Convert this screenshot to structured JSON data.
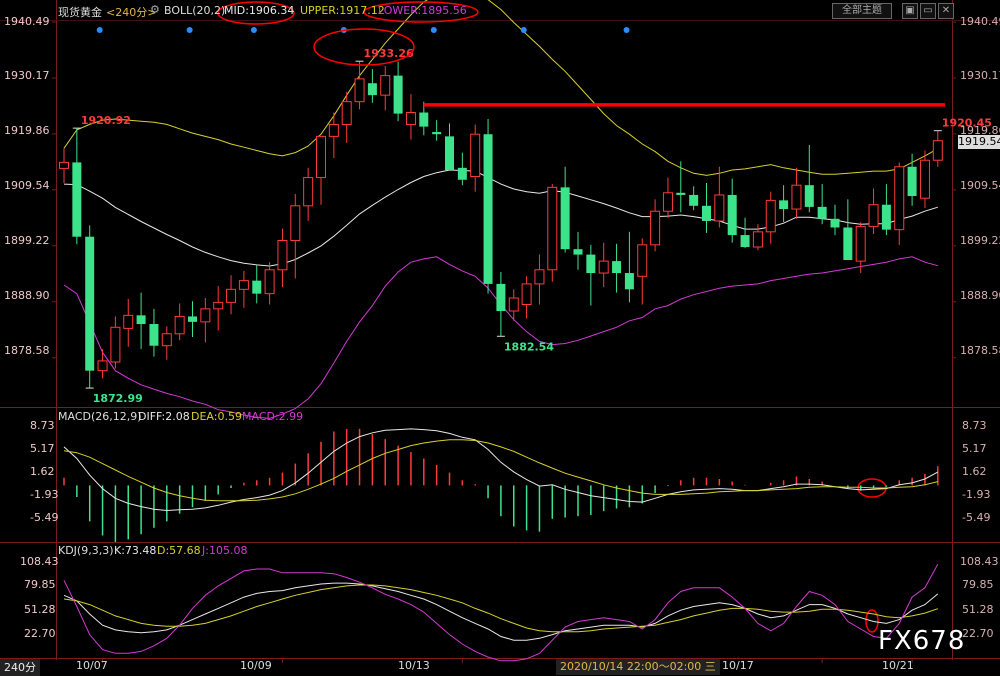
{
  "header": {
    "symbol": "现货黄金",
    "period": "<240分>",
    "boll": "BOLL(20,2)",
    "mid": "MID:1906.34",
    "upper": "UPPER:1917.12",
    "lower": "LOWER:1895.56",
    "theme_button": "全部主题",
    "window_buttons": [
      "▣",
      "▭",
      "✕"
    ]
  },
  "colors": {
    "up": "#ff3a3a",
    "down": "#3de38a",
    "mid": "#e8e8e8",
    "upper": "#d8d02a",
    "lower": "#d43ad4",
    "annot": "#ff0000"
  },
  "chart_data": {
    "type": "candlestick",
    "price_axis": {
      "min": 1869.5,
      "max": 1940.49,
      "ticks": [
        "1940.49",
        "1930.17",
        "1919.86",
        "1909.54",
        "1899.22",
        "1888.90",
        "1878.58"
      ]
    },
    "price_axis_right": [
      "1940.49",
      "1930.17",
      "1919.86",
      "1909.54",
      "1899.22",
      "1888.90",
      "1878.58"
    ],
    "right_current": "1919.54",
    "candles": [
      [
        1913.5,
        1917.2,
        1910.8,
        1914.6
      ],
      [
        1914.6,
        1920.9,
        1899.5,
        1900.9
      ],
      [
        1900.9,
        1903.0,
        1872.99,
        1876.2
      ],
      [
        1876.2,
        1880.2,
        1874.8,
        1878.0
      ],
      [
        1877.8,
        1886.2,
        1876.6,
        1884.2
      ],
      [
        1884.0,
        1889.4,
        1880.6,
        1886.4
      ],
      [
        1886.4,
        1890.6,
        1880.2,
        1884.8
      ],
      [
        1884.8,
        1887.6,
        1878.8,
        1880.8
      ],
      [
        1880.8,
        1884.4,
        1878.2,
        1883.0
      ],
      [
        1883.0,
        1888.6,
        1881.8,
        1886.2
      ],
      [
        1886.2,
        1889.0,
        1882.4,
        1885.2
      ],
      [
        1885.2,
        1889.6,
        1881.4,
        1887.6
      ],
      [
        1887.6,
        1891.8,
        1883.6,
        1888.8
      ],
      [
        1888.8,
        1893.8,
        1886.6,
        1891.2
      ],
      [
        1891.2,
        1894.6,
        1887.8,
        1892.8
      ],
      [
        1892.8,
        1895.6,
        1888.6,
        1890.4
      ],
      [
        1890.4,
        1896.2,
        1888.4,
        1894.8
      ],
      [
        1894.8,
        1902.4,
        1891.6,
        1900.2
      ],
      [
        1900.2,
        1908.8,
        1893.2,
        1906.6
      ],
      [
        1906.6,
        1913.6,
        1903.8,
        1911.8
      ],
      [
        1911.8,
        1916.8,
        1906.8,
        1919.4
      ],
      [
        1919.4,
        1923.8,
        1915.4,
        1921.6
      ],
      [
        1921.6,
        1927.6,
        1918.2,
        1925.8
      ],
      [
        1925.8,
        1933.26,
        1924.4,
        1930.0
      ],
      [
        1929.2,
        1931.8,
        1925.6,
        1927.0
      ],
      [
        1927.0,
        1932.4,
        1924.2,
        1930.6
      ],
      [
        1930.6,
        1933.2,
        1922.2,
        1923.6
      ],
      [
        1921.6,
        1927.2,
        1918.8,
        1923.8
      ],
      [
        1923.8,
        1925.8,
        1919.6,
        1921.2
      ],
      [
        1920.2,
        1922.4,
        1918.6,
        1919.8
      ],
      [
        1919.4,
        1921.8,
        1913.8,
        1913.2
      ],
      [
        1913.6,
        1916.4,
        1910.4,
        1911.4
      ],
      [
        1912.0,
        1921.6,
        1909.2,
        1919.8
      ],
      [
        1919.8,
        1922.6,
        1890.4,
        1892.2
      ],
      [
        1892.2,
        1894.4,
        1882.54,
        1887.2
      ],
      [
        1887.2,
        1891.2,
        1885.4,
        1889.6
      ],
      [
        1888.4,
        1893.6,
        1885.8,
        1892.2
      ],
      [
        1892.2,
        1897.6,
        1888.4,
        1894.8
      ],
      [
        1894.8,
        1910.6,
        1892.6,
        1910.0
      ],
      [
        1910.0,
        1913.8,
        1898.0,
        1898.6
      ],
      [
        1898.6,
        1901.8,
        1894.8,
        1897.6
      ],
      [
        1897.6,
        1899.4,
        1888.2,
        1894.2
      ],
      [
        1894.2,
        1899.8,
        1891.6,
        1896.4
      ],
      [
        1896.4,
        1899.6,
        1890.6,
        1894.2
      ],
      [
        1894.2,
        1901.8,
        1888.8,
        1891.2
      ],
      [
        1893.6,
        1900.6,
        1888.4,
        1899.4
      ],
      [
        1899.4,
        1907.8,
        1898.2,
        1905.6
      ],
      [
        1905.6,
        1911.8,
        1904.4,
        1909.0
      ],
      [
        1909.0,
        1914.8,
        1905.4,
        1908.6
      ],
      [
        1908.6,
        1910.2,
        1905.8,
        1906.6
      ],
      [
        1906.6,
        1910.8,
        1901.6,
        1903.8
      ],
      [
        1903.8,
        1913.8,
        1902.6,
        1908.6
      ],
      [
        1908.6,
        1911.6,
        1899.8,
        1901.2
      ],
      [
        1901.2,
        1904.4,
        1898.8,
        1899.0
      ],
      [
        1899.0,
        1903.2,
        1898.4,
        1901.8
      ],
      [
        1901.8,
        1909.2,
        1899.6,
        1907.6
      ],
      [
        1907.6,
        1910.4,
        1903.6,
        1906.0
      ],
      [
        1906.0,
        1913.6,
        1904.2,
        1910.4
      ],
      [
        1910.4,
        1917.8,
        1905.4,
        1906.4
      ],
      [
        1906.4,
        1910.6,
        1903.2,
        1904.2
      ],
      [
        1904.2,
        1906.8,
        1901.2,
        1902.6
      ],
      [
        1902.6,
        1907.8,
        1899.2,
        1896.6
      ],
      [
        1896.4,
        1903.6,
        1894.2,
        1902.8
      ],
      [
        1902.8,
        1909.8,
        1901.4,
        1906.8
      ],
      [
        1906.8,
        1910.6,
        1901.2,
        1902.2
      ],
      [
        1902.2,
        1914.6,
        1899.4,
        1913.8
      ],
      [
        1913.8,
        1916.2,
        1906.6,
        1908.4
      ],
      [
        1908.0,
        1916.8,
        1906.2,
        1915.0
      ],
      [
        1915.0,
        1920.45,
        1913.8,
        1918.6
      ]
    ],
    "mid_line": [
      1910.6,
      1910.5,
      1909.3,
      1908.0,
      1906.3,
      1905.0,
      1903.7,
      1902.5,
      1901.3,
      1900.2,
      1899.0,
      1898.0,
      1897.2,
      1896.5,
      1896.0,
      1895.7,
      1895.5,
      1895.9,
      1896.7,
      1897.9,
      1899.2,
      1901.0,
      1903.0,
      1905.1,
      1906.7,
      1908.2,
      1909.6,
      1910.9,
      1912.0,
      1912.7,
      1913.2,
      1913.1,
      1913.0,
      1911.8,
      1910.6,
      1909.7,
      1909.2,
      1908.9,
      1909.4,
      1909.1,
      1908.4,
      1907.7,
      1907.0,
      1906.2,
      1905.3,
      1904.6,
      1904.6,
      1904.7,
      1904.9,
      1904.6,
      1904.2,
      1903.8,
      1903.0,
      1902.3,
      1902.3,
      1902.7,
      1903.4,
      1904.5,
      1904.5,
      1904.2,
      1904.0,
      1903.5,
      1903.2,
      1903.3,
      1903.3,
      1904.1,
      1904.7,
      1905.6,
      1906.34
    ],
    "upper_line": [
      1917.2,
      1920.6,
      1921.6,
      1922.4,
      1922.6,
      1922.4,
      1922.2,
      1922.0,
      1921.6,
      1920.8,
      1920.0,
      1919.4,
      1918.8,
      1918.0,
      1917.4,
      1916.8,
      1916.2,
      1915.8,
      1916.4,
      1917.6,
      1919.8,
      1923.2,
      1927.0,
      1930.6,
      1933.6,
      1936.6,
      1939.2,
      1941.8,
      1944.2,
      1945.6,
      1946.8,
      1946.6,
      1946.2,
      1944.6,
      1942.8,
      1940.4,
      1938.2,
      1936.0,
      1933.6,
      1931.4,
      1928.8,
      1926.2,
      1923.6,
      1921.4,
      1919.8,
      1918.0,
      1916.6,
      1914.8,
      1913.6,
      1912.6,
      1912.2,
      1912.6,
      1913.2,
      1913.4,
      1913.8,
      1914.2,
      1913.6,
      1913.2,
      1912.8,
      1912.4,
      1912.4,
      1912.6,
      1912.8,
      1913.0,
      1913.0,
      1913.4,
      1914.6,
      1915.8,
      1917.12
    ],
    "lower_line": [
      1892.0,
      1890.4,
      1885.0,
      1879.6,
      1876.2,
      1874.8,
      1873.6,
      1872.8,
      1872.0,
      1871.4,
      1870.6,
      1870.0,
      1869.0,
      1868.6,
      1868.0,
      1867.6,
      1867.4,
      1868.2,
      1869.2,
      1871.0,
      1873.8,
      1877.6,
      1881.6,
      1885.2,
      1888.2,
      1891.8,
      1894.4,
      1896.2,
      1896.8,
      1897.2,
      1895.8,
      1894.6,
      1893.6,
      1891.4,
      1888.4,
      1885.6,
      1883.4,
      1881.6,
      1881.0,
      1881.2,
      1881.8,
      1882.6,
      1883.4,
      1884.2,
      1885.4,
      1886.0,
      1887.6,
      1888.2,
      1889.4,
      1890.2,
      1890.8,
      1891.4,
      1891.8,
      1892.0,
      1892.2,
      1892.8,
      1893.2,
      1893.6,
      1894.0,
      1894.2,
      1894.6,
      1895.0,
      1895.4,
      1895.8,
      1896.2,
      1896.8,
      1897.2,
      1896.2,
      1895.56
    ],
    "resistance_level": 1925.2,
    "markers": [
      2,
      9,
      14,
      21,
      28,
      35,
      43
    ],
    "annotations": [
      {
        "text": "1920.92",
        "price": 1920.92,
        "index": 1,
        "color": "#ff3a3a"
      },
      {
        "text": "1933.26",
        "price": 1933.26,
        "index": 23,
        "color": "#ff3a3a"
      },
      {
        "text": "1872.99",
        "price": 1872.99,
        "index": 2,
        "color": "#3de38a"
      },
      {
        "text": "1882.54",
        "price": 1882.54,
        "index": 34,
        "color": "#3de38a"
      },
      {
        "text": "1920.45",
        "price": 1920.45,
        "index": 68,
        "color": "#ff3a3a"
      }
    ],
    "macd": {
      "title": "MACD(26,12,9)",
      "diff": "DIFF:2.08",
      "dea": "DEA:0.59",
      "macd": "MACD:2.99",
      "axis": {
        "min": -8.5,
        "max": 10.5,
        "ticks": [
          "8.73",
          "5.17",
          "1.62",
          "-1.93",
          "-5.49"
        ]
      },
      "diff_line": [
        6.0,
        4.2,
        1.6,
        -0.5,
        -2.0,
        -2.8,
        -3.3,
        -3.7,
        -3.9,
        -3.8,
        -3.7,
        -3.5,
        -3.1,
        -2.6,
        -2.2,
        -1.9,
        -1.5,
        -0.8,
        0.4,
        1.9,
        3.6,
        5.3,
        6.6,
        7.6,
        8.2,
        8.6,
        8.7,
        8.8,
        8.7,
        8.5,
        8.1,
        7.5,
        7.1,
        5.6,
        3.6,
        2.1,
        0.9,
        -0.1,
        0.1,
        -0.6,
        -1.1,
        -1.6,
        -1.9,
        -2.2,
        -2.5,
        -2.6,
        -2.0,
        -1.4,
        -1.0,
        -0.7,
        -0.6,
        -0.5,
        -0.6,
        -0.8,
        -0.8,
        -0.5,
        -0.2,
        0.2,
        0.2,
        0.1,
        -0.2,
        -0.5,
        -0.7,
        -0.6,
        -0.5,
        0.1,
        0.4,
        1.0,
        2.08
      ],
      "dea_line": [
        5.4,
        5.1,
        4.4,
        3.4,
        2.4,
        1.4,
        0.5,
        -0.4,
        -1.1,
        -1.6,
        -2.0,
        -2.3,
        -2.4,
        -2.4,
        -2.4,
        -2.3,
        -2.1,
        -1.8,
        -1.3,
        -0.6,
        0.2,
        1.1,
        2.2,
        3.2,
        4.2,
        5.0,
        5.6,
        6.2,
        6.6,
        6.9,
        7.1,
        7.1,
        7.0,
        6.6,
        6.0,
        5.3,
        4.4,
        3.5,
        2.7,
        1.9,
        1.3,
        0.7,
        0.1,
        -0.4,
        -0.8,
        -1.2,
        -1.4,
        -1.4,
        -1.4,
        -1.3,
        -1.2,
        -1.0,
        -0.9,
        -0.8,
        -0.8,
        -0.7,
        -0.6,
        -0.5,
        -0.3,
        -0.2,
        -0.2,
        -0.3,
        -0.3,
        -0.4,
        -0.4,
        -0.3,
        -0.2,
        0.1,
        0.59
      ],
      "hist": [
        1.2,
        -1.8,
        -5.6,
        -7.8,
        -8.8,
        -8.4,
        -7.6,
        -6.6,
        -5.6,
        -4.4,
        -3.4,
        -2.4,
        -1.4,
        -0.4,
        0.4,
        0.8,
        1.2,
        2.0,
        3.4,
        5.0,
        6.8,
        8.4,
        8.8,
        8.8,
        8.0,
        7.2,
        6.2,
        5.2,
        4.2,
        3.2,
        2.0,
        0.8,
        0.2,
        -2.0,
        -4.8,
        -6.4,
        -7.0,
        -7.2,
        -5.2,
        -5.0,
        -4.8,
        -4.6,
        -4.0,
        -3.6,
        -3.4,
        -2.8,
        -1.2,
        -0.1,
        0.8,
        1.2,
        1.2,
        1.0,
        0.6,
        0.1,
        0.0,
        0.4,
        0.8,
        1.4,
        1.0,
        0.6,
        0.0,
        -0.4,
        -0.8,
        -0.4,
        -0.2,
        0.8,
        1.2,
        1.8,
        2.99
      ]
    },
    "kdj": {
      "title": "KDJ(9,3,3)",
      "k": "K:73.48",
      "d": "D:57.68",
      "j": "J:105.08",
      "axis": {
        "min": 5,
        "max": 115,
        "ticks": [
          "108.43",
          "79.85",
          "51.28",
          "22.70"
        ]
      },
      "k_line": [
        72,
        66,
        52,
        40,
        35,
        33,
        32,
        33,
        35,
        40,
        46,
        52,
        58,
        64,
        70,
        74,
        76,
        77,
        80,
        82,
        84,
        85,
        85,
        84,
        82,
        79,
        76,
        72,
        68,
        62,
        55,
        48,
        42,
        36,
        28,
        24,
        24,
        26,
        30,
        34,
        36,
        38,
        40,
        40,
        40,
        38,
        42,
        50,
        56,
        60,
        62,
        64,
        62,
        58,
        52,
        48,
        50,
        56,
        62,
        62,
        58,
        52,
        48,
        44,
        42,
        46,
        56,
        62,
        73.48
      ],
      "d_line": [
        68,
        66,
        62,
        56,
        50,
        46,
        42,
        40,
        39,
        39,
        40,
        42,
        46,
        50,
        55,
        60,
        64,
        68,
        72,
        75,
        78,
        80,
        82,
        83,
        83,
        82,
        80,
        78,
        75,
        72,
        68,
        64,
        58,
        53,
        47,
        42,
        37,
        34,
        33,
        33,
        33,
        34,
        36,
        37,
        38,
        39,
        40,
        43,
        46,
        50,
        53,
        56,
        58,
        58,
        57,
        55,
        54,
        54,
        55,
        57,
        57,
        56,
        54,
        52,
        49,
        48,
        50,
        53,
        57.68
      ],
      "j_line": [
        88,
        60,
        30,
        14,
        10,
        10,
        12,
        18,
        26,
        40,
        58,
        72,
        82,
        90,
        98,
        100,
        100,
        96,
        96,
        96,
        96,
        95,
        91,
        86,
        80,
        73,
        68,
        62,
        54,
        42,
        30,
        20,
        12,
        6,
        2,
        2,
        4,
        10,
        24,
        38,
        44,
        46,
        48,
        46,
        44,
        36,
        46,
        64,
        76,
        80,
        80,
        80,
        70,
        58,
        42,
        34,
        42,
        60,
        76,
        72,
        62,
        44,
        36,
        28,
        26,
        42,
        70,
        80,
        105.08
      ]
    },
    "x_labels": [
      {
        "text": "10/07",
        "index": 3
      },
      {
        "text": "10/09",
        "index": 17
      },
      {
        "text": "10/13",
        "index": 31
      },
      {
        "text": "10/17",
        "index": 59
      },
      {
        "text": "10/21",
        "index": 66
      }
    ],
    "cursor_label": "2020/10/14 22:00～02:00 三",
    "period_label": "240分",
    "watermark": "FX678"
  }
}
